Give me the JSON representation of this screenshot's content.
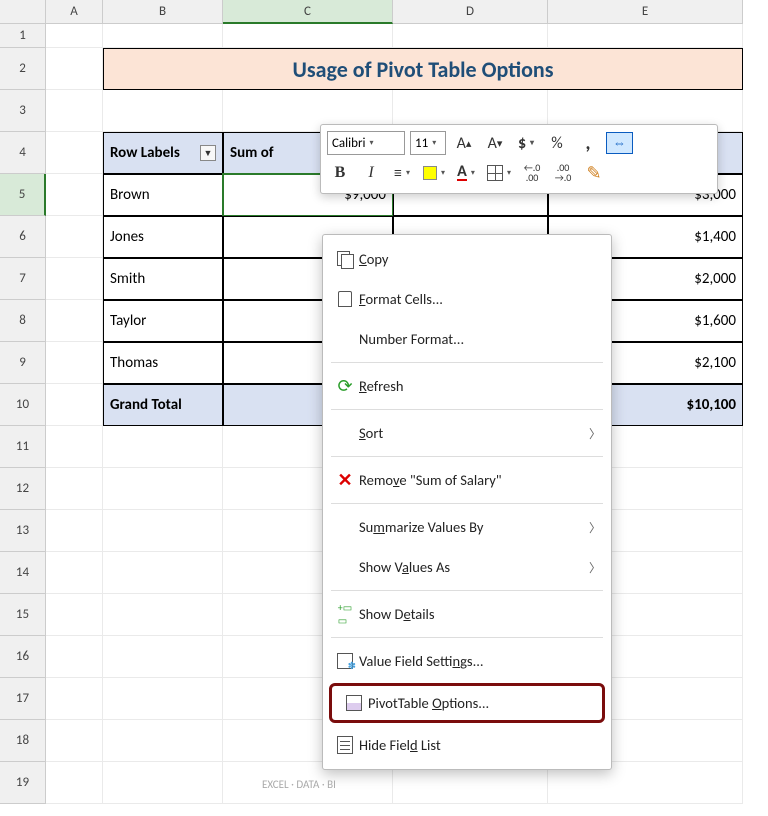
{
  "columns": [
    "A",
    "B",
    "C",
    "D",
    "E"
  ],
  "row_numbers": [
    1,
    2,
    3,
    4,
    5,
    6,
    7,
    8,
    9,
    10,
    11,
    12,
    13,
    14,
    15,
    16,
    17,
    18,
    19
  ],
  "title": "Usage of Pivot Table Options",
  "pivot": {
    "row_labels_header": "Row Labels",
    "col2_header_partial": "Sum of",
    "rows": [
      {
        "name": "Brown",
        "c": "$9,000",
        "e": "$3,000"
      },
      {
        "name": "Jones",
        "c": "",
        "e": "$1,400"
      },
      {
        "name": "Smith",
        "c": "",
        "e": "$2,000"
      },
      {
        "name": "Taylor",
        "c": "",
        "e": "$1,600"
      },
      {
        "name": "Thomas",
        "c": "",
        "e": "$2,100"
      }
    ],
    "grand_total_label": "Grand Total",
    "grand_total_c_partial": "$",
    "grand_total_e": "$10,100"
  },
  "mini_toolbar": {
    "font": "Calibri",
    "size": "11",
    "grow_font": "A",
    "shrink_font": "A",
    "dollar": "$",
    "percent": "%",
    "comma": ",",
    "bold": "B",
    "italic": "I",
    "font_color_letter": "A",
    "inc_dec_1": "←.0",
    "inc_dec_1b": ".00",
    "inc_dec_2": ".00",
    "inc_dec_2b": "→.0"
  },
  "context_menu": {
    "copy": "Copy",
    "format_cells": "Format Cells...",
    "number_format": "Number Format...",
    "refresh": "Refresh",
    "sort": "Sort",
    "remove": "Remove \"Sum of Salary\"",
    "summarize": "Summarize Values By",
    "show_values": "Show Values As",
    "show_details": "Show Details",
    "value_field": "Value Field Settings...",
    "pivot_options": "PivotTable Options...",
    "hide_list": "Hide Field List"
  },
  "watermark": "EXCEL · DATA · BI"
}
